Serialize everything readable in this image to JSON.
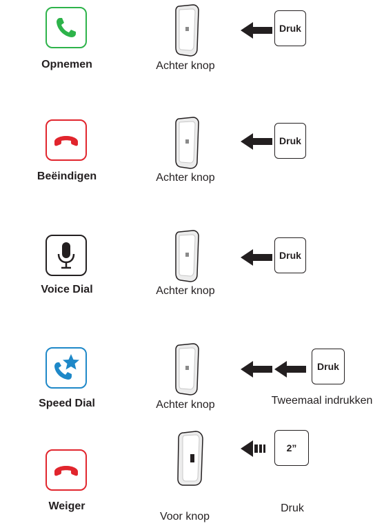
{
  "rows": [
    {
      "function": "Opnemen",
      "icon": "phone-answer-icon",
      "icon_color": "#2db34a",
      "button": "Achter knop",
      "press": "Druk",
      "sub": ""
    },
    {
      "function": "Beëindigen",
      "icon": "phone-hangup-icon",
      "icon_color": "#e1252d",
      "button": "Achter knop",
      "press": "Druk",
      "sub": ""
    },
    {
      "function": "Voice Dial",
      "icon": "microphone-icon",
      "icon_color": "#231f20",
      "button": "Achter knop",
      "press": "Druk",
      "sub": ""
    },
    {
      "function": "Speed Dial",
      "icon": "phone-star-icon",
      "icon_color": "#1e88c8",
      "button": "Achter knop",
      "press": "Druk",
      "sub": "Tweemaal indrukken"
    },
    {
      "function": "Weiger",
      "icon": "phone-hangup-icon",
      "icon_color": "#e1252d",
      "button": "Voor knop",
      "press": "2”",
      "sub": "Druk"
    }
  ]
}
